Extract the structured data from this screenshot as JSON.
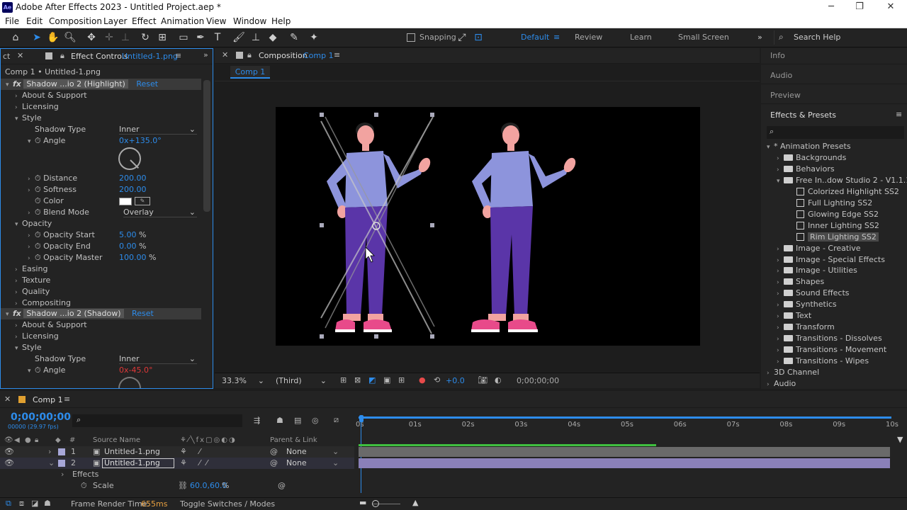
{
  "app": {
    "title": "Adobe After Effects 2023 - Untitled Project.aep *",
    "logo": "Ae"
  },
  "menu": [
    "File",
    "Edit",
    "Composition",
    "Layer",
    "Effect",
    "Animation",
    "View",
    "Window",
    "Help"
  ],
  "toolbar": {
    "snapping": "Snapping",
    "workspaces": [
      "Default",
      "Review",
      "Learn",
      "Small Screen"
    ],
    "search_placeholder": "Search Help"
  },
  "effect_controls": {
    "tab_prefix": "ct",
    "tab_label": "Effect Controls",
    "tab_file": "Untitled-1.png",
    "breadcrumb": "Comp 1 • Untitled-1.png",
    "reset": "Reset",
    "effect1": {
      "name": "Shadow ...io 2 (Highlight)",
      "about": "About & Support",
      "licensing": "Licensing",
      "style": "Style",
      "shadow_type_label": "Shadow Type",
      "shadow_type": "Inner",
      "angle_label": "Angle",
      "angle": "0x+135.0°",
      "distance_label": "Distance",
      "distance": "200.00",
      "softness_label": "Softness",
      "softness": "200.00",
      "color_label": "Color",
      "blend_label": "Blend Mode",
      "blend": "Overlay",
      "opacity": "Opacity",
      "op_start_label": "Opacity Start",
      "op_start": "5.00",
      "op_end_label": "Opacity End",
      "op_end": "0.00",
      "op_master_label": "Opacity Master",
      "op_master": "100.00",
      "pct": "%",
      "easing": "Easing",
      "texture": "Texture",
      "quality": "Quality",
      "compositing": "Compositing"
    },
    "effect2": {
      "name": "Shadow ...io 2 (Shadow)",
      "about": "About & Support",
      "licensing": "Licensing",
      "style": "Style",
      "shadow_type_label": "Shadow Type",
      "shadow_type": "Inner",
      "angle_label": "Angle",
      "angle": "0x-45.0°"
    }
  },
  "composition": {
    "tab_label": "Composition",
    "tab_comp": "Comp 1",
    "sub_tab": "Comp 1",
    "zoom": "33.3%",
    "view": "(Third)",
    "exposure": "+0.0",
    "timecode": "0;00;00;00"
  },
  "right_panel": {
    "info": "Info",
    "audio": "Audio",
    "preview": "Preview",
    "effects_presets": "Effects & Presets",
    "tree": [
      {
        "label": "* Animation Presets",
        "level": 0,
        "open": true
      },
      {
        "label": "Backgrounds",
        "level": 1,
        "folder": true
      },
      {
        "label": "Behaviors",
        "level": 1,
        "folder": true
      },
      {
        "label": "Free In..dow Studio 2 - V1.1.1",
        "level": 1,
        "folder": true,
        "open": true
      },
      {
        "label": "Colorized Highlight SS2",
        "level": 2
      },
      {
        "label": "Full Lighting SS2",
        "level": 2
      },
      {
        "label": "Glowing Edge SS2",
        "level": 2
      },
      {
        "label": "Inner Lighting SS2",
        "level": 2
      },
      {
        "label": "Rim Lighting SS2",
        "level": 2,
        "selected": true
      },
      {
        "label": "Image - Creative",
        "level": 1,
        "folder": true
      },
      {
        "label": "Image - Special Effects",
        "level": 1,
        "folder": true
      },
      {
        "label": "Image - Utilities",
        "level": 1,
        "folder": true
      },
      {
        "label": "Shapes",
        "level": 1,
        "folder": true
      },
      {
        "label": "Sound Effects",
        "level": 1,
        "folder": true
      },
      {
        "label": "Synthetics",
        "level": 1,
        "folder": true
      },
      {
        "label": "Text",
        "level": 1,
        "folder": true
      },
      {
        "label": "Transform",
        "level": 1,
        "folder": true
      },
      {
        "label": "Transitions - Dissolves",
        "level": 1,
        "folder": true
      },
      {
        "label": "Transitions - Movement",
        "level": 1,
        "folder": true
      },
      {
        "label": "Transitions - Wipes",
        "level": 1,
        "folder": true
      },
      {
        "label": "3D Channel",
        "level": 0
      },
      {
        "label": "Audio",
        "level": 0
      }
    ]
  },
  "timeline": {
    "tab": "Comp 1",
    "timecode": "0;00;00;00",
    "fps": "00000 (29.97 fps)",
    "col_source": "Source Name",
    "col_parent": "Parent & Link",
    "col_hash": "#",
    "ruler": [
      "0s",
      "01s",
      "02s",
      "03s",
      "04s",
      "05s",
      "06s",
      "07s",
      "08s",
      "09s",
      "10s"
    ],
    "layers": [
      {
        "num": "1",
        "name": "Untitled-1.png",
        "parent": "None"
      },
      {
        "num": "2",
        "name": "Untitled-1.png",
        "parent": "None"
      }
    ],
    "effects": "Effects",
    "scale_label": "Scale",
    "scale": "60.0,60.0",
    "pct": "%",
    "render_label": "Frame Render Time:",
    "render_time": "655ms",
    "toggle": "Toggle Switches / Modes"
  }
}
